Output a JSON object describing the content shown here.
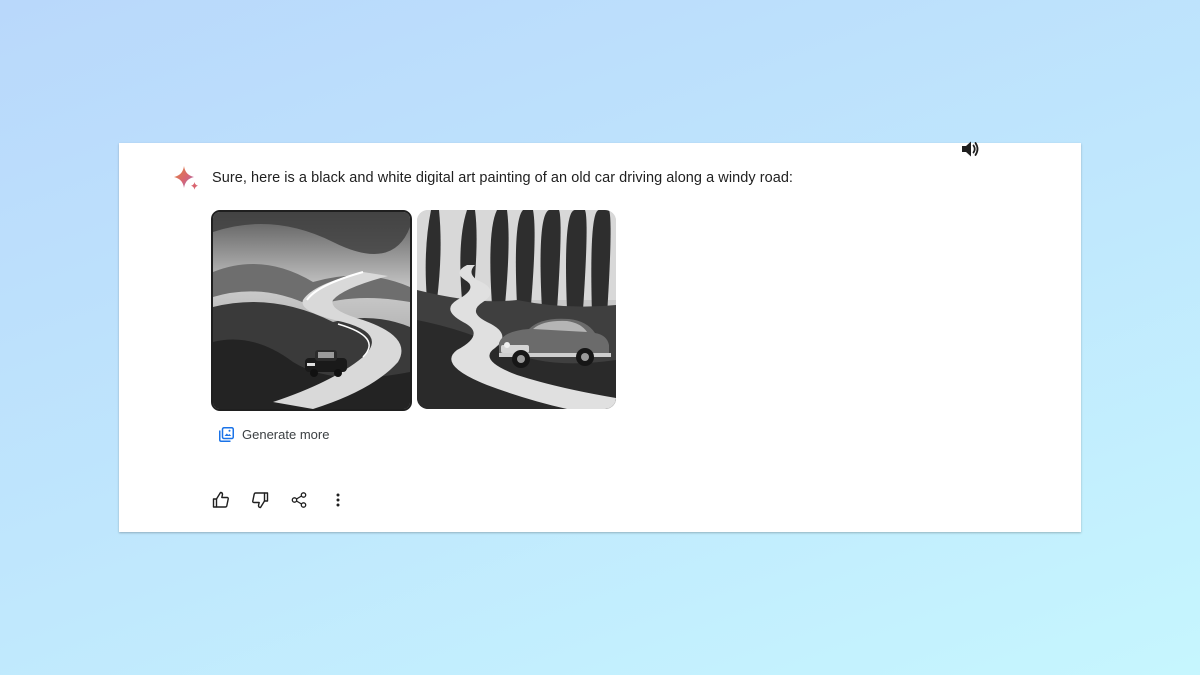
{
  "response": {
    "text": "Sure, here is a black and white digital art painting of an old car driving along a windy road:"
  },
  "images": [
    {
      "icon": "generated-image-1",
      "selected": true
    },
    {
      "icon": "generated-image-2",
      "selected": false
    }
  ],
  "generate_more": {
    "label": "Generate more",
    "icon": "generate-images-icon"
  },
  "actions": [
    {
      "icon": "thumbs-up-icon"
    },
    {
      "icon": "thumbs-down-icon"
    },
    {
      "icon": "share-icon"
    },
    {
      "icon": "more-vert-icon"
    }
  ],
  "toolbar": {
    "speaker_icon": "volume-icon"
  },
  "colors": {
    "background_top": "#b9d8fb",
    "background_bottom": "#c6f6fe",
    "card": "#ffffff",
    "text": "#1f1f1f",
    "accent_blue": "#1a73e8",
    "sparkle_pink": "#d96570",
    "sparkle_gold": "#d9a14a"
  }
}
